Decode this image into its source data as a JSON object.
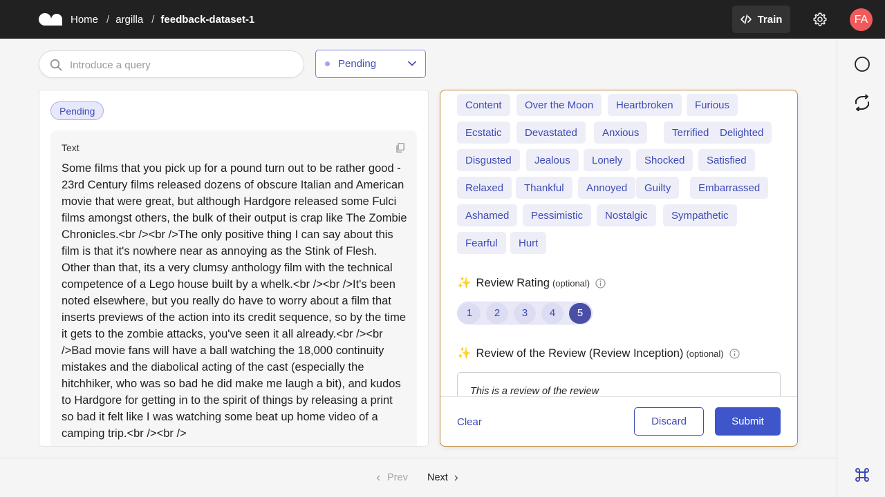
{
  "header": {
    "breadcrumbs": [
      "Home",
      "argilla",
      "feedback-dataset-1"
    ],
    "train_label": "Train",
    "avatar_initials": "FA",
    "avatar_color": "#f05a5a"
  },
  "search": {
    "placeholder": "Introduce a query",
    "value": ""
  },
  "status_filter": {
    "selected": "Pending"
  },
  "record": {
    "status_badge": "Pending",
    "field_title": "Text",
    "field_text": "Some films that you pick up for a pound turn out to be rather good - 23rd Century films released dozens of obscure Italian and American movie that were great, but although Hardgore released some Fulci films amongst others, the bulk of their output is crap like The Zombie Chronicles.<br /><br />The only positive thing I can say about this film is that it's nowhere near as annoying as the Stink of Flesh. Other than that, its a very clumsy anthology film with the technical competence of a Lego house built by a whelk.<br /><br />It's been noted elsewhere, but you really do have to worry about a film that inserts previews of the action into its credit sequence, so by the time it gets to the zombie attacks, you've seen it all already.<br /><br />Bad movie fans will have a ball watching the 18,000 continuity mistakes and the diabolical acting of the cast (especially the hitchhiker, who was so bad he did make me laugh a bit), and kudos to Hardgore for getting in to the spirit of things by releasing a print so bad it felt like I was watching some beat up home video of a camping trip.<br /><br />"
  },
  "questions": {
    "emotion_options": [
      "Content",
      "Over the Moon",
      "Heartbroken",
      "Furious",
      "Ecstatic",
      "Devastated",
      "Anxious",
      "Terrified",
      "Delighted",
      "Disgusted",
      "Jealous",
      "Lonely",
      "Shocked",
      "Satisfied",
      "Relaxed",
      "Thankful",
      "Annoyed",
      "Guilty",
      "Embarrassed",
      "Ashamed",
      "Pessimistic",
      "Nostalgic",
      "Sympathetic",
      "Fearful",
      "Hurt"
    ],
    "rating": {
      "title": "Review Rating",
      "optional_label": "(optional)",
      "options": [
        "1",
        "2",
        "3",
        "4",
        "5"
      ],
      "selected": "5"
    },
    "review_text": {
      "title": "Review of the Review (Review Inception)",
      "optional_label": "(optional)",
      "value": "This is a review of the review"
    }
  },
  "actions": {
    "clear": "Clear",
    "discard": "Discard",
    "submit": "Submit"
  },
  "pagination": {
    "prev": "Prev",
    "next": "Next"
  },
  "colors": {
    "accent": "#3e4bb5",
    "submit": "#3e56c9",
    "panel_border": "#c08a3a",
    "topbar": "#212121"
  }
}
